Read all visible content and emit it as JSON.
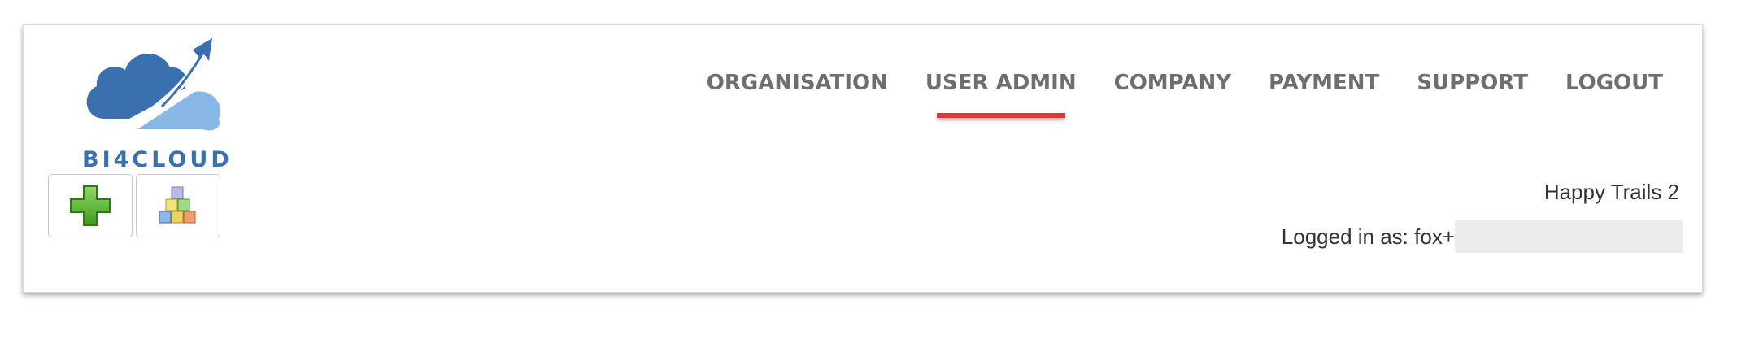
{
  "logo": {
    "text": "BI4CLOUD"
  },
  "nav": {
    "items": [
      {
        "label": "ORGANISATION",
        "active": false
      },
      {
        "label": "USER ADMIN",
        "active": true
      },
      {
        "label": "COMPANY",
        "active": false
      },
      {
        "label": "PAYMENT",
        "active": false
      },
      {
        "label": "SUPPORT",
        "active": false
      },
      {
        "label": "LOGOUT",
        "active": false
      }
    ],
    "active_color": "#e2392b"
  },
  "toolbar": {
    "buttons": [
      {
        "icon": "green-plus-icon"
      },
      {
        "icon": "stacked-blocks-icon"
      }
    ]
  },
  "account": {
    "organisation": "Happy Trails 2",
    "logged_in_label": "Logged in as: fox+"
  },
  "colors": {
    "brand_blue": "#3a6fb0",
    "brand_light_blue": "#8ab8e6",
    "nav_text": "#6e6e6e"
  }
}
